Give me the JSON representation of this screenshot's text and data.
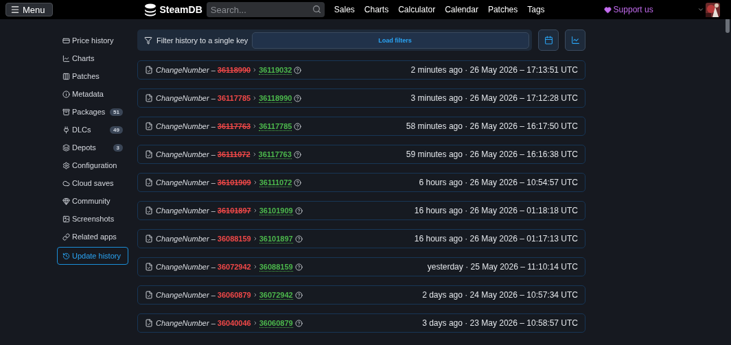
{
  "header": {
    "menu_label": "Menu",
    "logo_text": "SteamDB",
    "search": {
      "placeholder": "Search..."
    },
    "nav": [
      "Sales",
      "Charts",
      "Calculator",
      "Calendar",
      "Patches",
      "Tags"
    ],
    "support_label": "Support us"
  },
  "sidebar": {
    "items": [
      {
        "label": "Price history",
        "selected": false
      },
      {
        "label": "Charts",
        "selected": false
      },
      {
        "label": "Patches",
        "selected": false
      },
      {
        "label": "Metadata",
        "selected": false
      },
      {
        "label": "Packages",
        "count": "51",
        "selected": false
      },
      {
        "label": "DLCs",
        "count": "49",
        "selected": false
      },
      {
        "label": "Depots",
        "count": "3",
        "selected": false
      },
      {
        "label": "Configuration",
        "selected": false
      },
      {
        "label": "Cloud saves",
        "selected": false
      },
      {
        "label": "Community",
        "selected": false
      },
      {
        "label": "Screenshots",
        "selected": false
      },
      {
        "label": "Related apps",
        "selected": false
      },
      {
        "label": "Update history",
        "selected": true
      }
    ]
  },
  "filter": {
    "label": "Filter history to a single key",
    "button": "Load filters"
  },
  "entries": [
    {
      "key": "ChangeNumber",
      "separator": "–",
      "old": "36118990",
      "old_struck": true,
      "new": "36119032",
      "time": "2 minutes ago · 26 May 2026 – 17:13:51 UTC"
    },
    {
      "key": "ChangeNumber",
      "separator": "–",
      "old": "36117785",
      "old_struck": false,
      "new": "36118990",
      "time": "3 minutes ago · 26 May 2026 – 17:12:28 UTC"
    },
    {
      "key": "ChangeNumber",
      "separator": "–",
      "old": "36117763",
      "old_struck": true,
      "new": "36117785",
      "time": "58 minutes ago · 26 May 2026 – 16:17:50 UTC"
    },
    {
      "key": "ChangeNumber",
      "separator": "–",
      "old": "36111072",
      "old_struck": true,
      "new": "36117763",
      "time": "59 minutes ago · 26 May 2026 – 16:16:38 UTC"
    },
    {
      "key": "ChangeNumber",
      "separator": "–",
      "old": "36101909",
      "old_struck": true,
      "new": "36111072",
      "time": "6 hours ago · 26 May 2026 – 10:54:57 UTC"
    },
    {
      "key": "ChangeNumber",
      "separator": "–",
      "old": "36101897",
      "old_struck": true,
      "new": "36101909",
      "time": "16 hours ago · 26 May 2026 – 01:18:18 UTC"
    },
    {
      "key": "ChangeNumber",
      "separator": "–",
      "old": "36088159",
      "old_struck": false,
      "new": "36101897",
      "time": "16 hours ago · 26 May 2026 – 01:17:13 UTC"
    },
    {
      "key": "ChangeNumber",
      "separator": "–",
      "old": "36072942",
      "old_struck": false,
      "new": "36088159",
      "time": "yesterday · 25 May 2026 – 11:10:14 UTC"
    },
    {
      "key": "ChangeNumber",
      "separator": "–",
      "old": "36060879",
      "old_struck": false,
      "new": "36072942",
      "time": "2 days ago · 24 May 2026 – 10:57:34 UTC"
    },
    {
      "key": "ChangeNumber",
      "separator": "–",
      "old": "36040046",
      "old_struck": false,
      "new": "36060879",
      "time": "3 days ago · 23 May 2026 – 10:58:57 UTC"
    }
  ]
}
